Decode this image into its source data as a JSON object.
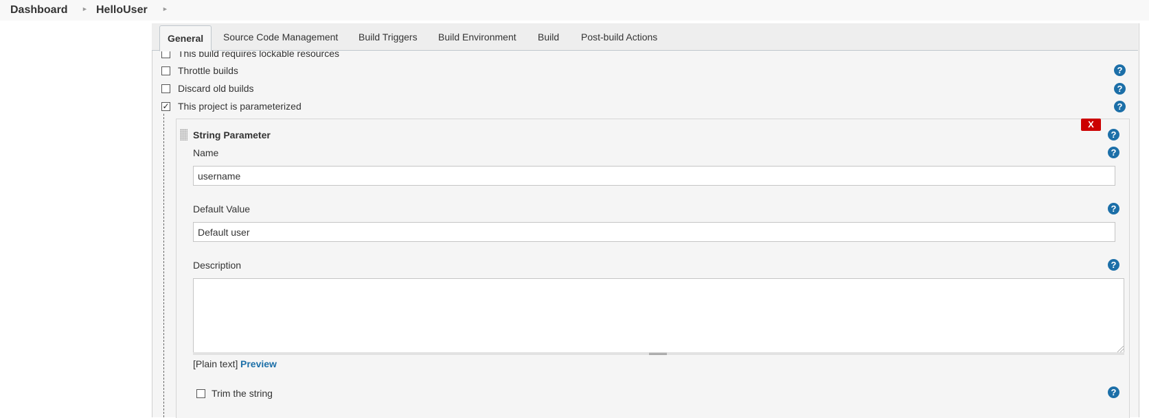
{
  "breadcrumb": {
    "items": [
      "Dashboard",
      "HelloUser"
    ],
    "separator_icon": "chevron-right-icon"
  },
  "tabs": [
    {
      "label": "General",
      "active": true
    },
    {
      "label": "Source Code Management",
      "active": false
    },
    {
      "label": "Build Triggers",
      "active": false
    },
    {
      "label": "Build Environment",
      "active": false
    },
    {
      "label": "Build",
      "active": false
    },
    {
      "label": "Post-build Actions",
      "active": false
    }
  ],
  "general_options": [
    {
      "label": "This build requires lockable resources",
      "checked": false
    },
    {
      "label": "Throttle builds",
      "checked": false
    },
    {
      "label": "Discard old builds",
      "checked": false
    },
    {
      "label": "This project is parameterized",
      "checked": true
    }
  ],
  "parameter": {
    "type_title": "String Parameter",
    "delete_label": "X",
    "name_label": "Name",
    "name_value": "username",
    "default_label": "Default Value",
    "default_value": "Default user",
    "description_label": "Description",
    "description_value": "",
    "format_note": "[Plain text]",
    "preview_label": "Preview",
    "trim_label": "Trim the string",
    "trim_checked": false
  },
  "help_icon_glyph": "?",
  "colors": {
    "help_blue": "#1c6fa8",
    "delete_red": "#cc0000",
    "panel_bg": "#f5f5f5"
  }
}
